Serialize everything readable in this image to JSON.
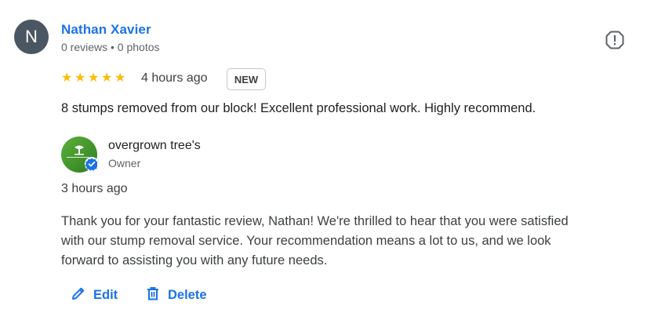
{
  "reviewer": {
    "initial": "N",
    "name": "Nathan Xavier",
    "meta": "0 reviews • 0 photos"
  },
  "review": {
    "rating": 5,
    "stars": "★★★★★",
    "time": "4 hours ago",
    "badge": "NEW",
    "text": "8 stumps removed from our block! Excellent professional work. Highly recommend."
  },
  "owner_reply": {
    "name": "overgrown tree's",
    "role": "Owner",
    "time": "3 hours ago",
    "lines": [
      "Thank you for your fantastic review, Nathan! We're thrilled to hear that you were satisfied",
      "with our stump removal service. Your recommendation means a lot to us, and we look",
      "forward to assisting you with any future needs."
    ]
  },
  "actions": {
    "edit_label": "Edit",
    "delete_label": "Delete"
  },
  "icons": {
    "report": "report-icon",
    "verified": "verified-badge-icon",
    "edit": "pencil-icon",
    "delete": "trash-icon"
  },
  "colors": {
    "link_blue": "#1a73e8",
    "star_yellow": "#fbbc04",
    "avatar_gray": "#4a5661",
    "owner_green": "#3e9a2c"
  }
}
